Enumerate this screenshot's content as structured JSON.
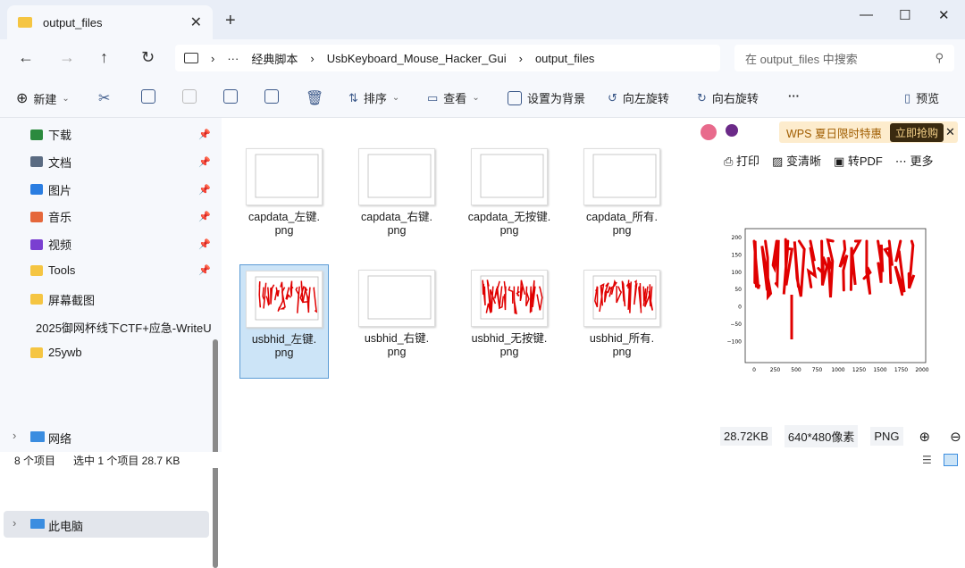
{
  "window": {
    "tab_title": "output_files",
    "tab_close": "✕",
    "new_tab": "+",
    "min": "—",
    "max": "☐",
    "close": "✕"
  },
  "nav": {
    "back": "←",
    "forward": "→",
    "up": "↑",
    "refresh": "↻"
  },
  "breadcrumb": {
    "more": "···",
    "items": [
      "经典脚本",
      "UsbKeyboard_Mouse_Hacker_Gui",
      "output_files"
    ]
  },
  "search": {
    "placeholder": "在 output_files 中搜索"
  },
  "toolbar": {
    "new": "新建",
    "sort": "排序",
    "view": "查看",
    "set_bg": "设置为背景",
    "rotate_left": "向左旋转",
    "rotate_right": "向右旋转",
    "more": "···",
    "preview": "预览"
  },
  "sidebar": {
    "items": [
      {
        "label": "下载",
        "pinned": true,
        "color": "#2b8a3e"
      },
      {
        "label": "文档",
        "pinned": true,
        "color": "#5a6b82"
      },
      {
        "label": "图片",
        "pinned": true,
        "color": "#2a7de1"
      },
      {
        "label": "音乐",
        "pinned": true,
        "color": "#e5673b"
      },
      {
        "label": "视频",
        "pinned": true,
        "color": "#7a3fd1"
      },
      {
        "label": "Tools",
        "pinned": true,
        "color": "#f5c542"
      },
      {
        "label": "屏幕截图",
        "pinned": false,
        "color": "#f5c542"
      },
      {
        "label": "2025御网杯线下CTF+应急-WriteU",
        "pinned": false,
        "color": "#f5c542"
      },
      {
        "label": "25ywb",
        "pinned": false,
        "color": "#f5c542"
      }
    ],
    "this_pc": "此电脑",
    "network": "网络"
  },
  "files": [
    {
      "name": "capdata_左键.png",
      "line1": "capdata_左键.",
      "line2": "png",
      "has_drawing": false,
      "selected": false
    },
    {
      "name": "capdata_右键.png",
      "line1": "capdata_右键.",
      "line2": "png",
      "has_drawing": false,
      "selected": false
    },
    {
      "name": "capdata_无按键.png",
      "line1": "capdata_无按键.",
      "line2": "png",
      "has_drawing": false,
      "selected": false
    },
    {
      "name": "capdata_所有.png",
      "line1": "capdata_所有.",
      "line2": "png",
      "has_drawing": false,
      "selected": false
    },
    {
      "name": "usbhid_左键.png",
      "line1": "usbhid_左键.",
      "line2": "png",
      "has_drawing": true,
      "selected": true
    },
    {
      "name": "usbhid_右键.png",
      "line1": "usbhid_右键.",
      "line2": "png",
      "has_drawing": false,
      "selected": false
    },
    {
      "name": "usbhid_无按键.png",
      "line1": "usbhid_无按键.",
      "line2": "png",
      "has_drawing": true,
      "selected": false
    },
    {
      "name": "usbhid_所有.png",
      "line1": "usbhid_所有.",
      "line2": "png",
      "has_drawing": true,
      "selected": false
    }
  ],
  "preview": {
    "wps_promo": "WPS 夏日限时特惠",
    "wps_buy": "立即抢购",
    "print": "打印",
    "sharpen": "变清晰",
    "to_pdf": "转PDF",
    "more": "更多",
    "size": "28.72KB",
    "dims": "640*480像素",
    "format": "PNG",
    "y_ticks": [
      "200",
      "150",
      "100",
      "50",
      "0",
      "−50",
      "−100"
    ],
    "x_ticks": [
      "0",
      "250",
      "500",
      "750",
      "1000",
      "1250",
      "1500",
      "1750",
      "2000"
    ],
    "stroke_color": "#e00000"
  },
  "status": {
    "count": "8 个项目",
    "selected": "选中 1 个项目 28.7 KB"
  }
}
